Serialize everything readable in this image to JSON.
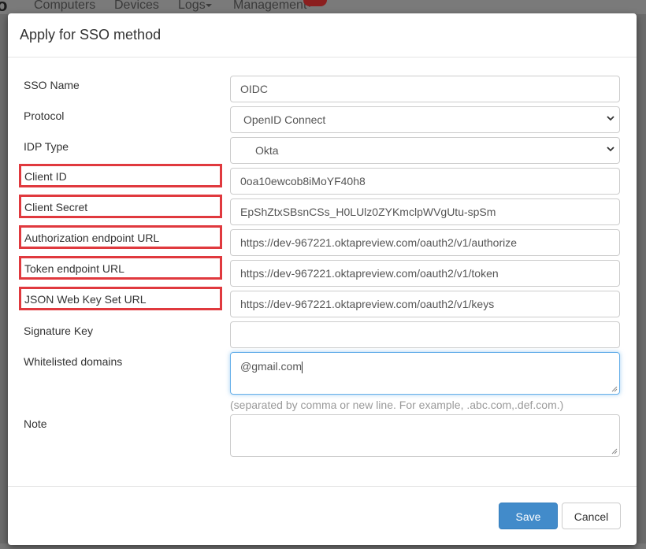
{
  "nav": {
    "logo": "o",
    "items": [
      "Computers",
      "Devices",
      "Logs",
      "Management"
    ]
  },
  "modal": {
    "title": "Apply for SSO method",
    "fields": [
      {
        "label": "SSO Name",
        "value": "OIDC"
      },
      {
        "label": "Protocol",
        "value": "OpenID Connect"
      },
      {
        "label": "IDP Type",
        "value": "Okta"
      },
      {
        "label": "Client ID",
        "value": "0oa10ewcob8iMoYF40h8"
      },
      {
        "label": "Client Secret",
        "value": "EpShZtxSBsnCSs_H0LUlz0ZYKmclpWVgUtu-spSm"
      },
      {
        "label": "Authorization endpoint URL",
        "value": "https://dev-967221.oktapreview.com/oauth2/v1/authorize"
      },
      {
        "label": "Token endpoint URL",
        "value": "https://dev-967221.oktapreview.com/oauth2/v1/token"
      },
      {
        "label": "JSON Web Key Set URL",
        "value": "https://dev-967221.oktapreview.com/oauth2/v1/keys"
      },
      {
        "label": "Signature Key",
        "value": ""
      },
      {
        "label": "Whitelisted domains",
        "value": "@gmail.com"
      },
      {
        "label": "Note",
        "value": ""
      }
    ],
    "whitelist_help": "(separated by comma or new line. For example, .abc.com,.def.com.)",
    "save_label": "Save",
    "cancel_label": "Cancel"
  },
  "colors": {
    "highlight": "#e0393e",
    "primary": "#428bca"
  }
}
